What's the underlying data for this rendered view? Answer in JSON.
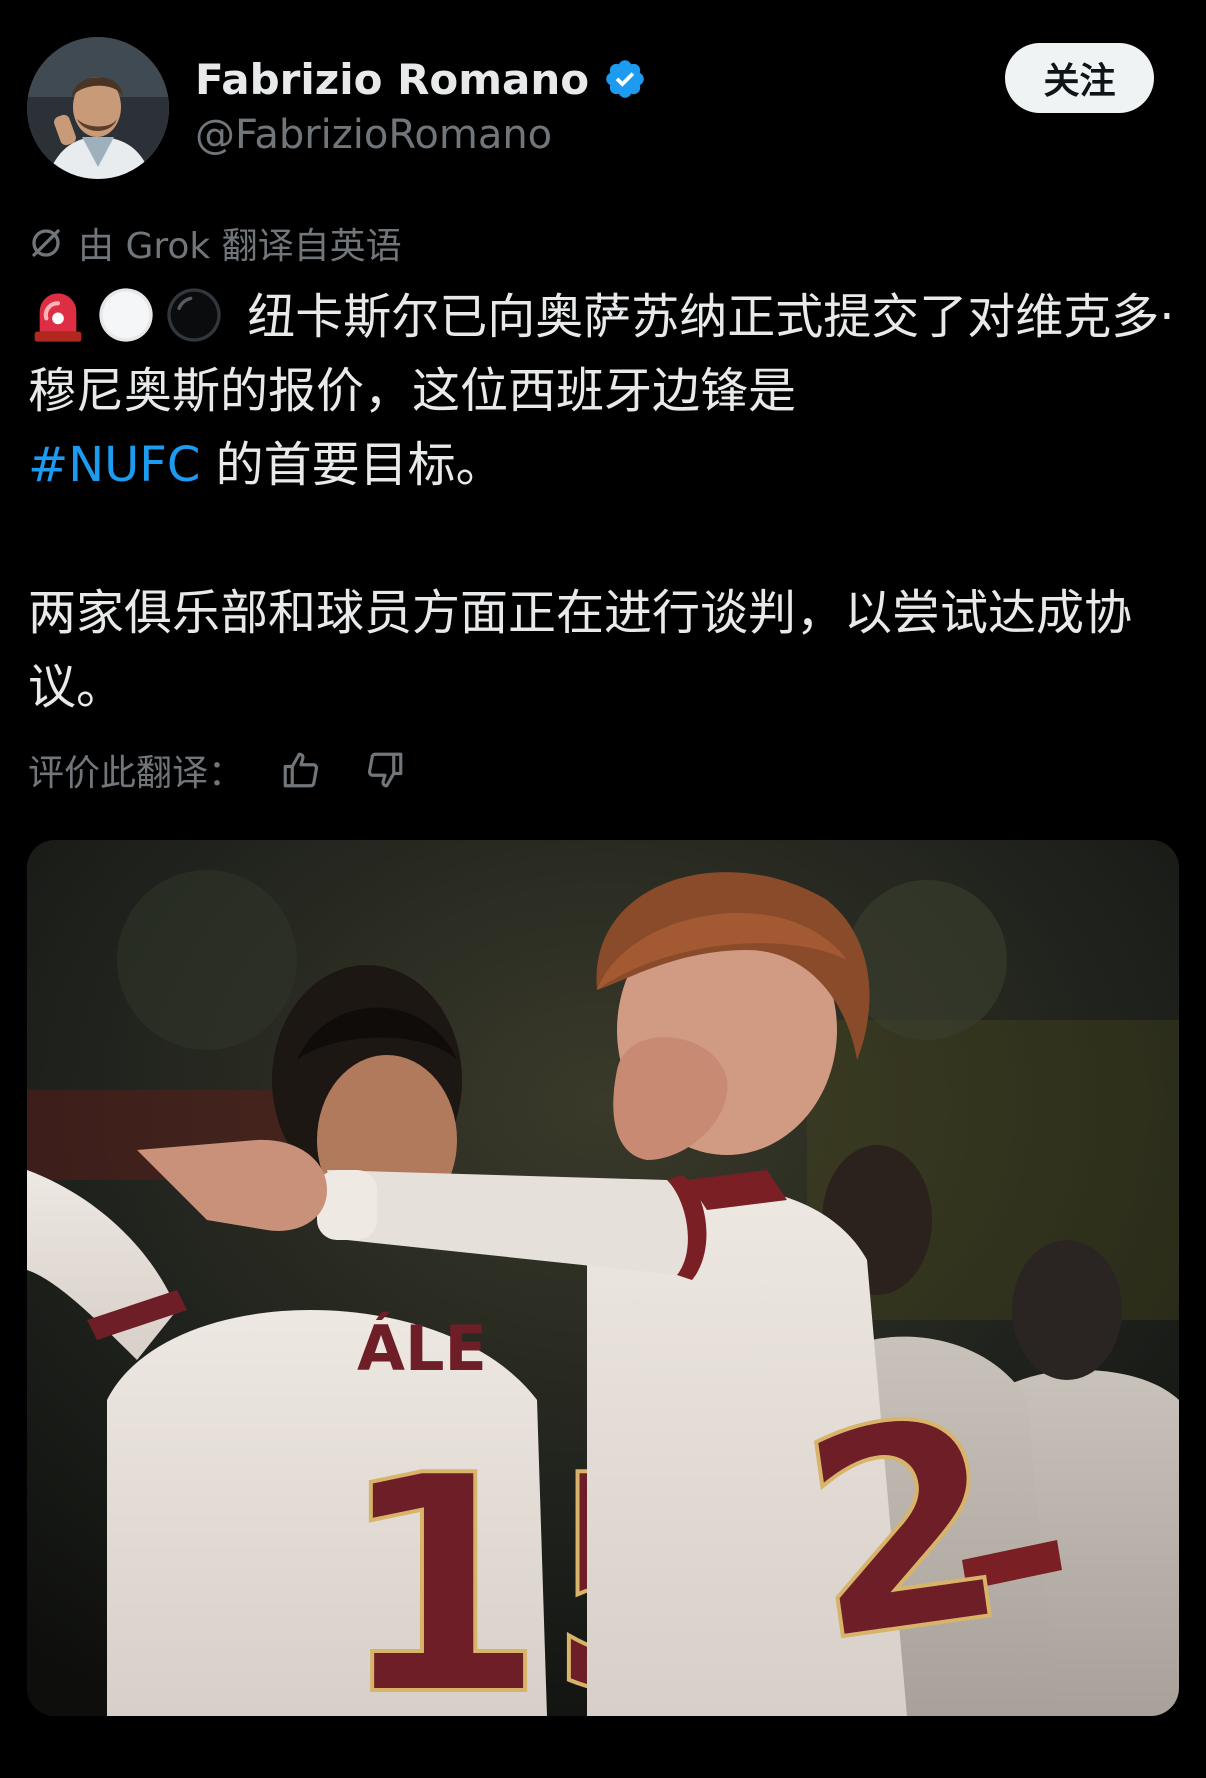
{
  "author": {
    "display_name": "Fabrizio Romano",
    "handle": "@FabrizioRomano",
    "verified": true,
    "avatar_icon": "profile-photo"
  },
  "follow_button": {
    "label": "关注"
  },
  "translation": {
    "note": "由 Grok 翻译自英语",
    "rate_label": "评价此翻译："
  },
  "tweet": {
    "emojis": [
      "rotating-light-emoji",
      "white-circle-emoji",
      "black-circle-emoji"
    ],
    "line1_text": "纽卡斯尔已向奥萨苏纳正式提交了对维克多·穆尼奥斯的报价，这位西班牙边锋是",
    "hashtag": "#NUFC",
    "line1_tail": "的首要目标。",
    "paragraph2": "两家俱乐部和球员方面正在进行谈判，以尝试达成协议。"
  },
  "media": {
    "jersey_left": "ÁLE",
    "jersey_number_left": "15",
    "jersey_number_right": "2"
  },
  "colors": {
    "background": "#000000",
    "text_primary": "#e7e9ea",
    "text_secondary": "#71767b",
    "accent": "#1d9bf0",
    "verified_badge": "#1d9bf0",
    "follow_bg": "#eff3f4"
  }
}
